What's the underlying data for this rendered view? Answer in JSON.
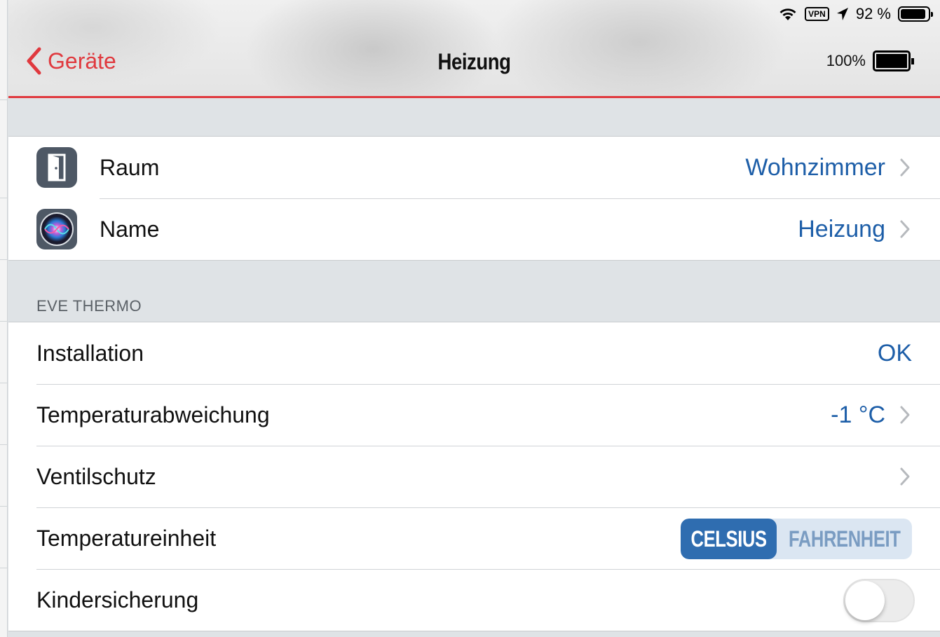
{
  "status_bar": {
    "vpn_label": "VPN",
    "battery_text": "92 %",
    "battery_level": 0.92
  },
  "nav": {
    "back_label": "Geräte",
    "title": "Heizung",
    "device_battery_text": "100%",
    "device_battery_level": 1.0,
    "accent_color": "#e0393e"
  },
  "top_group": [
    {
      "label": "Raum",
      "value": "Wohnzimmer",
      "icon": "door-icon"
    },
    {
      "label": "Name",
      "value": "Heizung",
      "icon": "siri-icon"
    }
  ],
  "section": {
    "header": "EVE THERMO",
    "rows": {
      "installation": {
        "label": "Installation",
        "value": "OK"
      },
      "offset": {
        "label": "Temperaturabweichung",
        "value": "-1 °C"
      },
      "valve": {
        "label": "Ventilschutz",
        "value": ""
      },
      "unit": {
        "label": "Temperatureinheit",
        "options": [
          "CELSIUS",
          "FAHRENHEIT"
        ],
        "selected": "CELSIUS"
      },
      "childlock": {
        "label": "Kindersicherung",
        "enabled": false
      }
    }
  },
  "colors": {
    "value_blue": "#1d5ea8",
    "segment_selected": "#2f6db0"
  }
}
